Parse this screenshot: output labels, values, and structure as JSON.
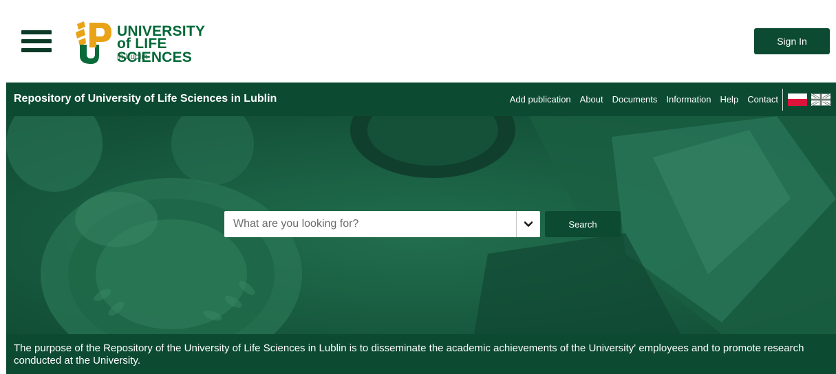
{
  "header": {
    "menu_icon": "hamburger-menu-icon",
    "logo": {
      "line1": "UNIVERSITY",
      "line2": "of LIFE SCIENCES",
      "line3": "in Lublin",
      "colors": {
        "gold": "#e8a317",
        "green": "#006837"
      }
    },
    "signin_label": "Sign In"
  },
  "navbar": {
    "title": "Repository of University of Life Sciences in Lublin",
    "links": [
      "Add publication",
      "About",
      "Documents",
      "Information",
      "Help",
      "Contact"
    ],
    "languages": [
      {
        "code": "pl",
        "icon": "flag-poland-icon"
      },
      {
        "code": "en",
        "icon": "flag-uk-icon"
      }
    ]
  },
  "search": {
    "placeholder": "What are you looking for?",
    "dropdown_icon": "chevron-down-icon",
    "button_label": "Search"
  },
  "purpose": {
    "text": "The purpose of the Repository of the University of Life Sciences in Lublin is to disseminate the academic achievements of the University' employees and to promote research conducted at the University."
  },
  "theme": {
    "primary": "#0c4a32",
    "hero_tint": "#1b6848",
    "background": "#ffffff"
  }
}
